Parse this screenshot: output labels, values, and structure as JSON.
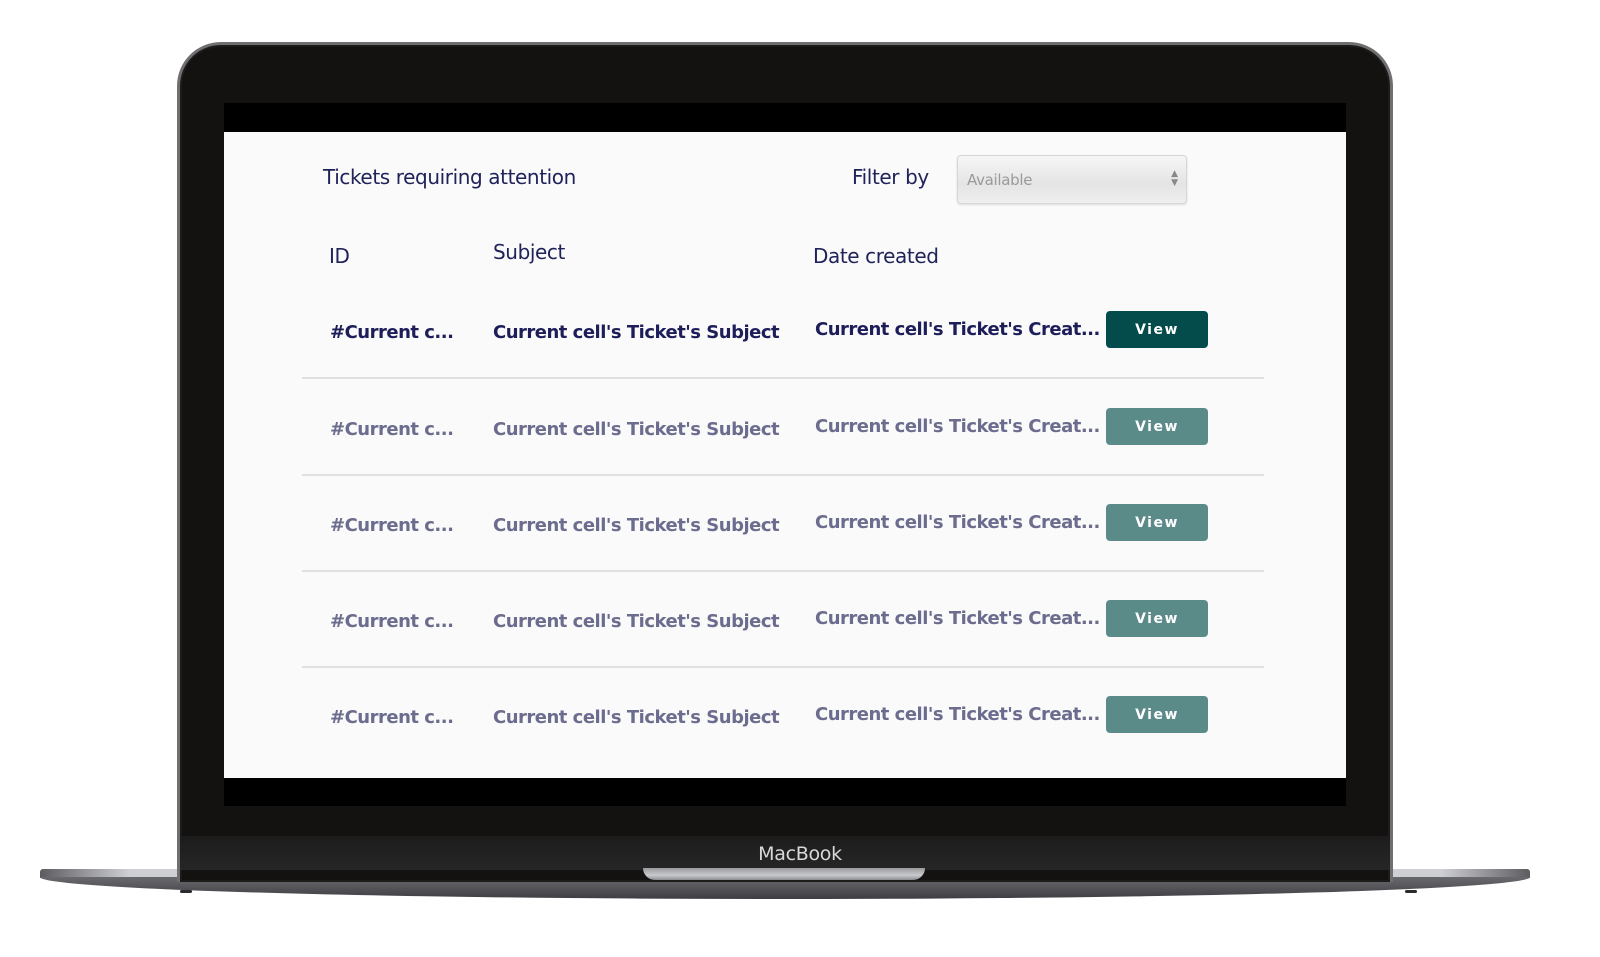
{
  "device": {
    "brand_label": "MacBook"
  },
  "header": {
    "title": "Tickets requiring attention",
    "filter_label": "Filter by",
    "filter_select": {
      "selected": "Available",
      "icon": "updown-arrows-icon"
    }
  },
  "table": {
    "columns": [
      {
        "label": "ID"
      },
      {
        "label": "Subject"
      },
      {
        "label": "Date created"
      }
    ],
    "rows": [
      {
        "id": "#Current c...",
        "subject": "Current cell's Ticket's Subject",
        "date": "Current cell's Ticket's Creat...",
        "button": "View",
        "state": "active"
      },
      {
        "id": "#Current c...",
        "subject": "Current cell's Ticket's Subject",
        "date": "Current cell's Ticket's Creat...",
        "button": "View",
        "state": "inactive"
      },
      {
        "id": "#Current c...",
        "subject": "Current cell's Ticket's Subject",
        "date": "Current cell's Ticket's Creat...",
        "button": "View",
        "state": "inactive"
      },
      {
        "id": "#Current c...",
        "subject": "Current cell's Ticket's Subject",
        "date": "Current cell's Ticket's Creat...",
        "button": "View",
        "state": "inactive"
      },
      {
        "id": "#Current c...",
        "subject": "Current cell's Ticket's Subject",
        "date": "Current cell's Ticket's Creat...",
        "button": "View",
        "state": "inactive"
      }
    ]
  },
  "colors": {
    "heading_text": "#20225a",
    "active_row_text": "#1d1d5a",
    "inactive_row_text": "#6c6c8e",
    "active_button": "#044b4b",
    "inactive_button": "#5b8b89"
  }
}
